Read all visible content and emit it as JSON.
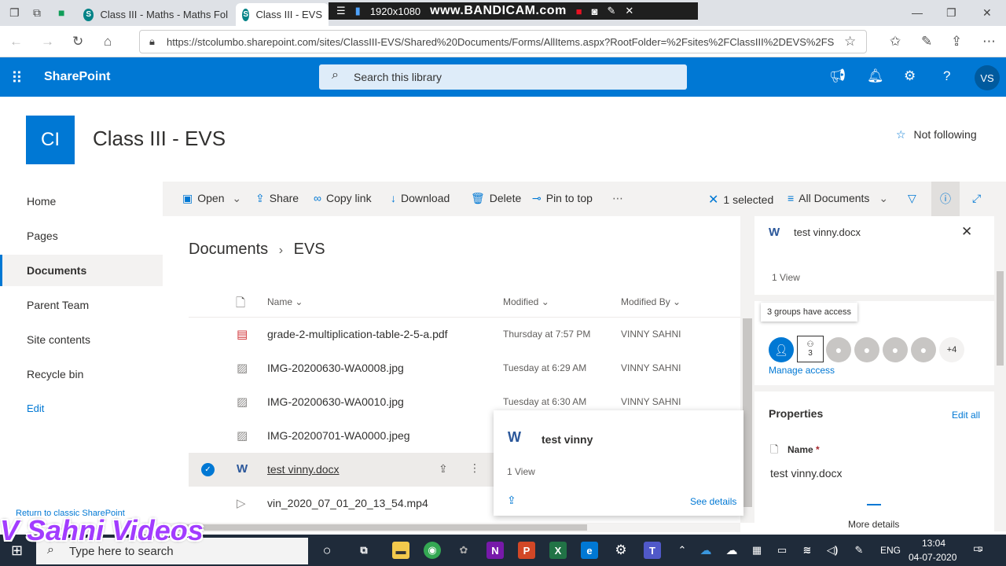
{
  "browser": {
    "tabs": [
      {
        "label": "Class III - Maths - Maths Fol",
        "active": false
      },
      {
        "label": "Class III - EVS",
        "active": true
      }
    ],
    "url": "https://stcolumbo.sharepoint.com/sites/ClassIII-EVS/Shared%20Documents/Forms/AllItems.aspx?RootFolder=%2Fsites%2FClassIII%2DEVS%2FS"
  },
  "recorder": {
    "resolution": "1920x1080",
    "brand": "www.BANDICAM.com"
  },
  "suite_bar": {
    "brand": "SharePoint",
    "search_placeholder": "Search this library",
    "user_initials": "VS",
    "accent": "#0078d4"
  },
  "site": {
    "logo_text": "CI",
    "title": "Class III - EVS",
    "follow_label": "Not following"
  },
  "left_nav": {
    "items": [
      {
        "label": "Home",
        "selected": false
      },
      {
        "label": "Pages",
        "selected": false
      },
      {
        "label": "Documents",
        "selected": true
      },
      {
        "label": "Parent Team",
        "selected": false
      },
      {
        "label": "Site contents",
        "selected": false
      },
      {
        "label": "Recycle bin",
        "selected": false
      }
    ],
    "edit_label": "Edit",
    "return_label": "Return to classic SharePoint"
  },
  "command_bar": {
    "open": "Open",
    "share": "Share",
    "copy_link": "Copy link",
    "download": "Download",
    "delete": "Delete",
    "pin": "Pin to top",
    "selected_count": "1 selected",
    "view": "All Documents"
  },
  "library": {
    "breadcrumb_root": "Documents",
    "breadcrumb_current": "EVS",
    "columns": {
      "name": "Name",
      "modified": "Modified",
      "modified_by": "Modified By"
    },
    "rows": [
      {
        "name": "grade-2-multiplication-table-2-5-a.pdf",
        "modified": "Thursday at 7:57 PM",
        "modified_by": "VINNY SAHNI",
        "type": "pdf",
        "selected": false
      },
      {
        "name": "IMG-20200630-WA0008.jpg",
        "modified": "Tuesday at 6:29 AM",
        "modified_by": "VINNY SAHNI",
        "type": "image",
        "selected": false
      },
      {
        "name": "IMG-20200630-WA0010.jpg",
        "modified": "Tuesday at 6:30 AM",
        "modified_by": "VINNY SAHNI",
        "type": "image",
        "selected": false
      },
      {
        "name": "IMG-20200701-WA0000.jpeg",
        "modified": "",
        "modified_by": "",
        "type": "image",
        "selected": false
      },
      {
        "name": "test vinny.docx",
        "modified": "",
        "modified_by": "",
        "type": "word",
        "selected": true
      },
      {
        "name": "vin_2020_07_01_20_13_54.mp4",
        "modified": "",
        "modified_by": "",
        "type": "video",
        "selected": false
      }
    ]
  },
  "hover_card": {
    "title": "test vinny",
    "views": "1 View",
    "see_details": "See details"
  },
  "details_pane": {
    "file_name": "test vinny.docx",
    "views": "1 View",
    "access_tooltip": "3 groups have access",
    "group_count": "3",
    "more_count": "+4",
    "manage_access": "Manage access",
    "properties_title": "Properties",
    "edit_all": "Edit all",
    "name_label": "Name",
    "required_mark": "*",
    "name_value": "test vinny.docx",
    "more_details": "More details"
  },
  "taskbar": {
    "search_placeholder": "Type here to search",
    "lang": "ENG",
    "time": "13:04",
    "date": "04-07-2020",
    "notification_count": "5"
  },
  "watermark": "V Sahni Videos"
}
